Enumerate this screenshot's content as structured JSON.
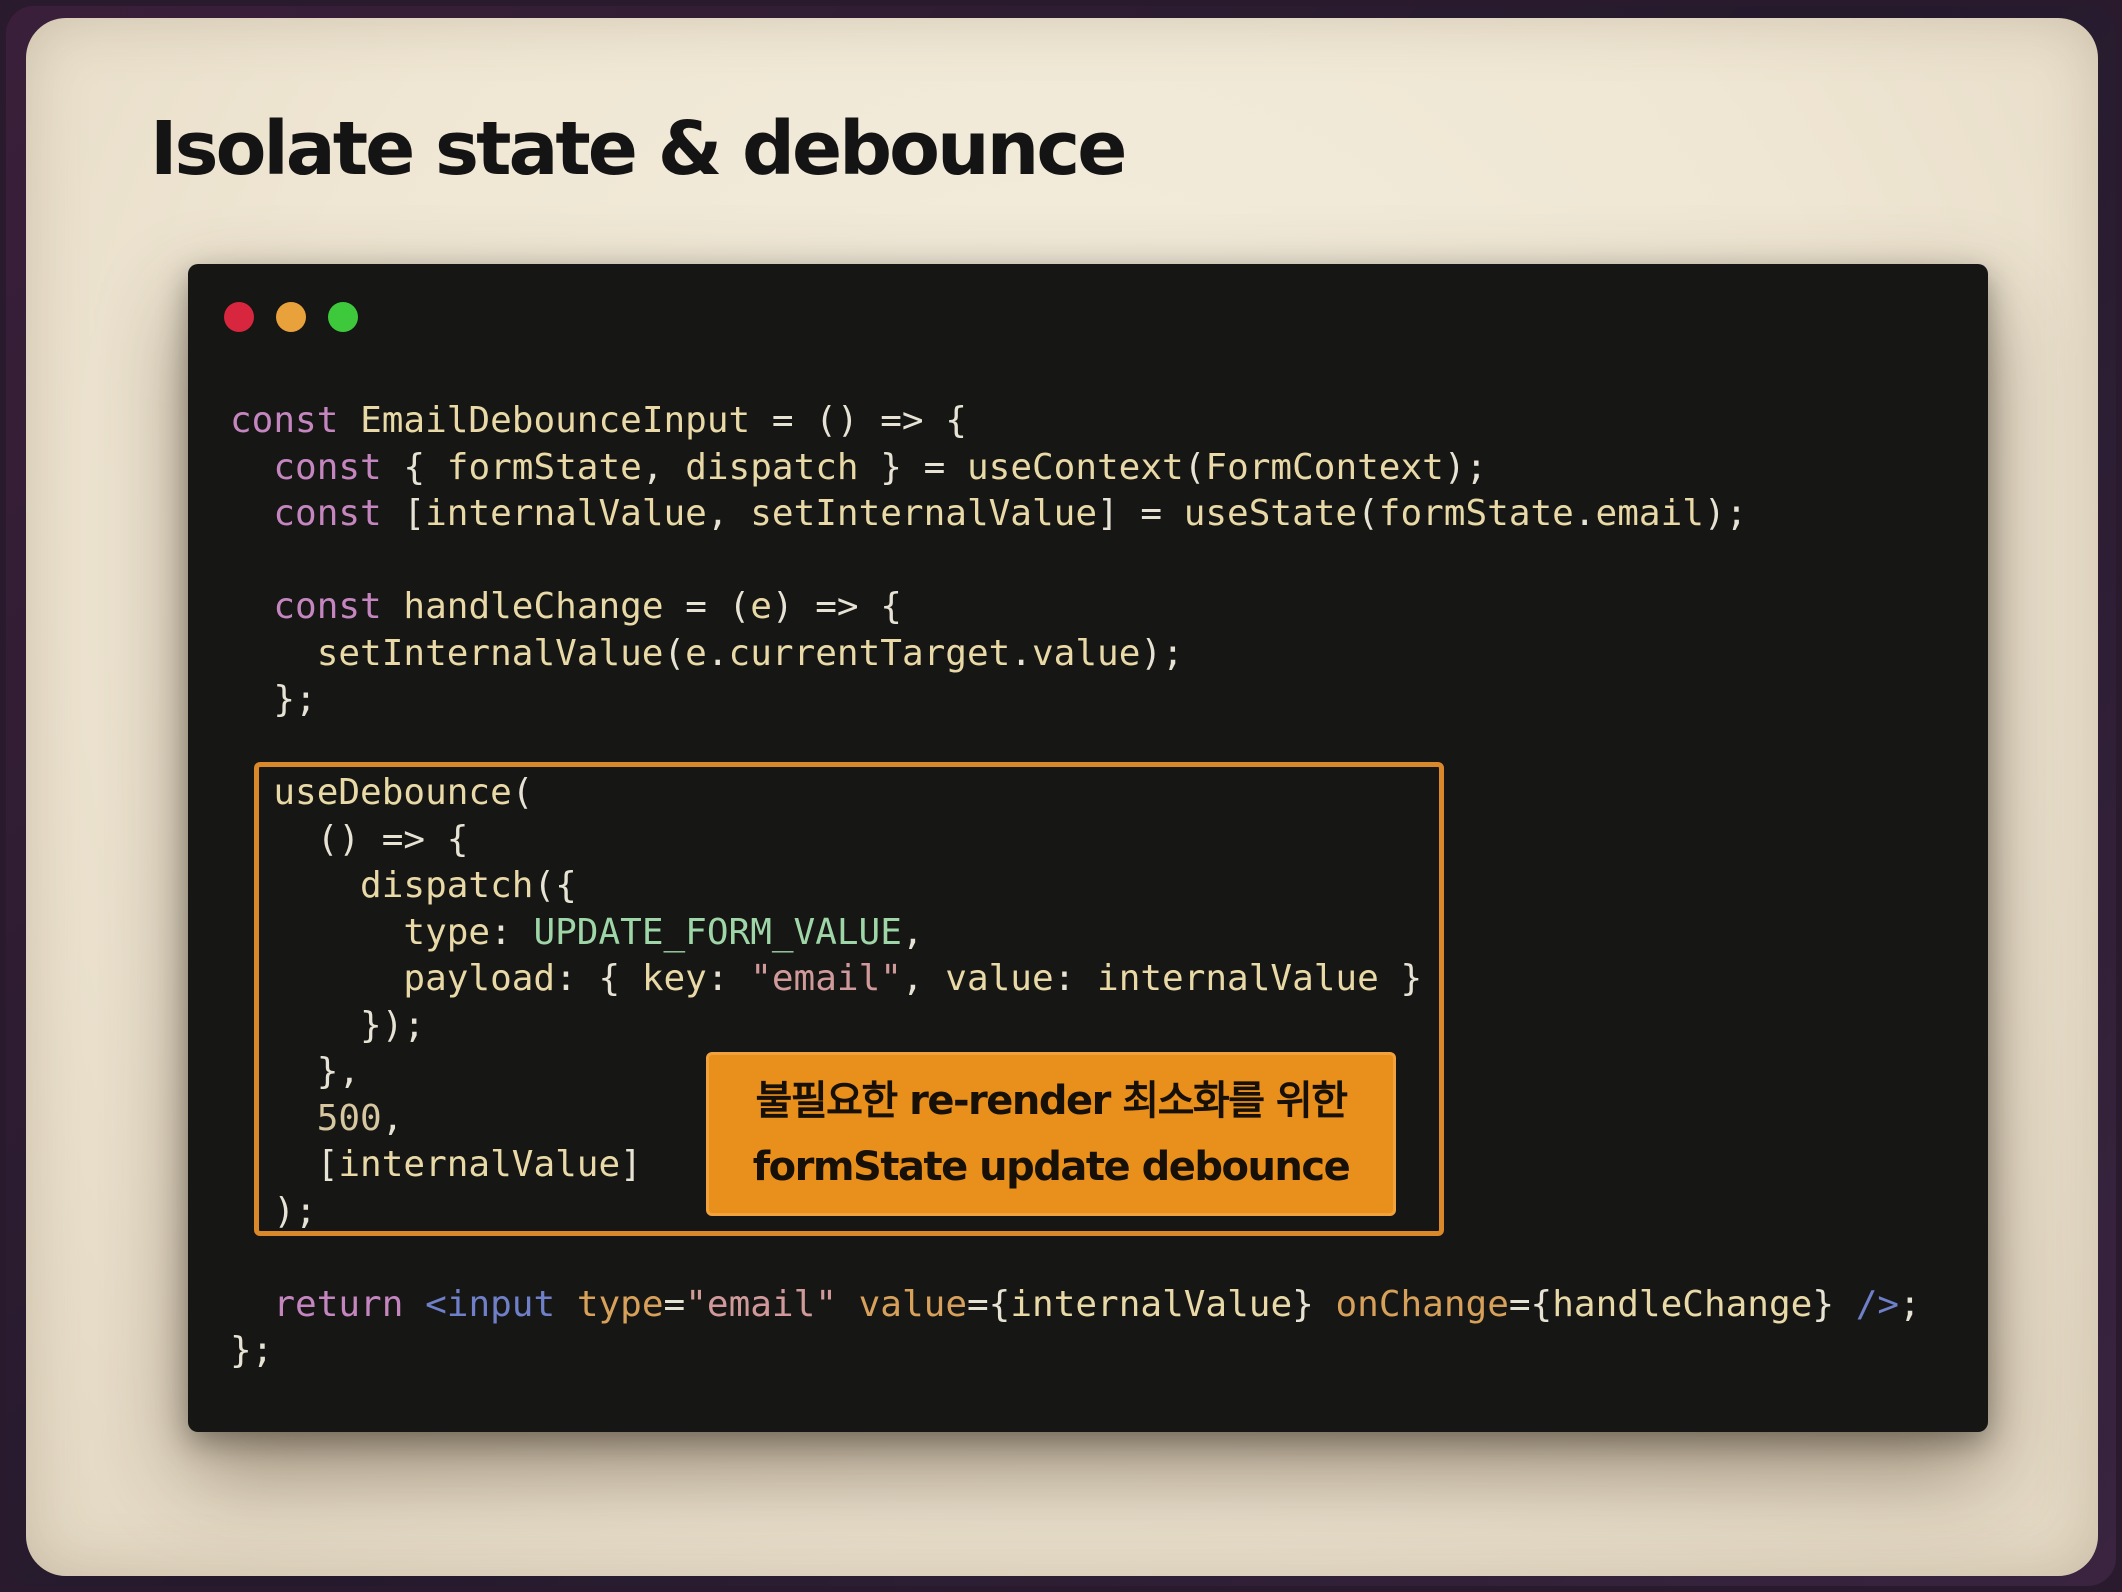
{
  "slide": {
    "title": "Isolate state & debounce"
  },
  "window": {
    "controls": [
      "close",
      "minimize",
      "maximize"
    ],
    "colors": {
      "close": "#d7263d",
      "minimize": "#e9a23b",
      "maximize": "#3ec93c",
      "background": "#161615",
      "highlight_border": "#d9892a",
      "callout_bg": "#e98f1b"
    }
  },
  "code": {
    "language": "jsx",
    "lines": [
      "const EmailDebounceInput = () => {",
      "  const { formState, dispatch } = useContext(FormContext);",
      "  const [internalValue, setInternalValue] = useState(formState.email);",
      "",
      "  const handleChange = (e) => {",
      "    setInternalValue(e.currentTarget.value);",
      "  };",
      "",
      "  useDebounce(",
      "    () => {",
      "      dispatch({",
      "        type: UPDATE_FORM_VALUE,",
      "        payload: { key: \"email\", value: internalValue }",
      "      });",
      "    },",
      "    500,",
      "    [internalValue]",
      "  );",
      "",
      "  return <input type=\"email\" value={internalValue} onChange={handleChange} />;",
      "};"
    ]
  },
  "callout": {
    "line1": "불필요한 re-render 최소화를 위한",
    "line2": "formState update debounce"
  }
}
